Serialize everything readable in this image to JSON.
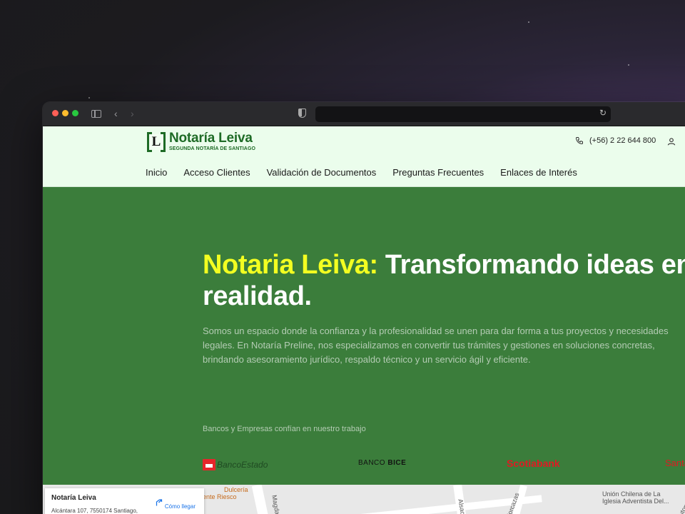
{
  "browser": {
    "url": ""
  },
  "site": {
    "brand": {
      "title": "Notaría Leiva",
      "subtitle": "SEGUNDA NOTARÍA DE SANTIAGO",
      "mark": "L"
    },
    "phone": "(+56) 2 22 644 800",
    "nav": [
      {
        "label": "Inicio"
      },
      {
        "label": "Acceso Clientes"
      },
      {
        "label": "Validación de Documentos"
      },
      {
        "label": "Preguntas Frecuentes"
      },
      {
        "label": "Enlaces de Interés"
      }
    ]
  },
  "hero": {
    "title_highlight": "Notaria Leiva:",
    "title_rest": " Transformando ideas en",
    "title_line2": "realidad.",
    "description": "Somos un espacio donde la confianza y la profesionalidad se unen para dar forma a tus proyectos y necesidades legales. En Notaría Preline, nos especializamos en convertir tus trámites y gestiones en soluciones concretas, brindando asesoramiento jurídico, respaldo técnico y un servicio ágil y eficiente."
  },
  "partners": {
    "label": "Bancos y Empresas confían en nuestro trabajo",
    "logos": [
      {
        "name": "BancoEstado"
      },
      {
        "name_light": "BANCO ",
        "name_bold": "BICE"
      },
      {
        "name": "Scotiabank"
      },
      {
        "name": "Santander"
      }
    ]
  },
  "map": {
    "place_name": "Notaría Leiva",
    "address": "Alcántara 107, 7550174 Santiago,",
    "directions_label": "Cómo llegar",
    "labels": [
      "Dulcería",
      "ente Riesco",
      "Magdal",
      "Alsac",
      "Forcazas",
      "Unión Chilena de La",
      "Iglesia Adventista Del...",
      "Autop. V"
    ]
  },
  "colors": {
    "hero_bg": "#3b7d3b",
    "header_bg": "#ebfdec",
    "brand_green": "#1e6b26",
    "highlight_yellow": "#f3ff21"
  }
}
